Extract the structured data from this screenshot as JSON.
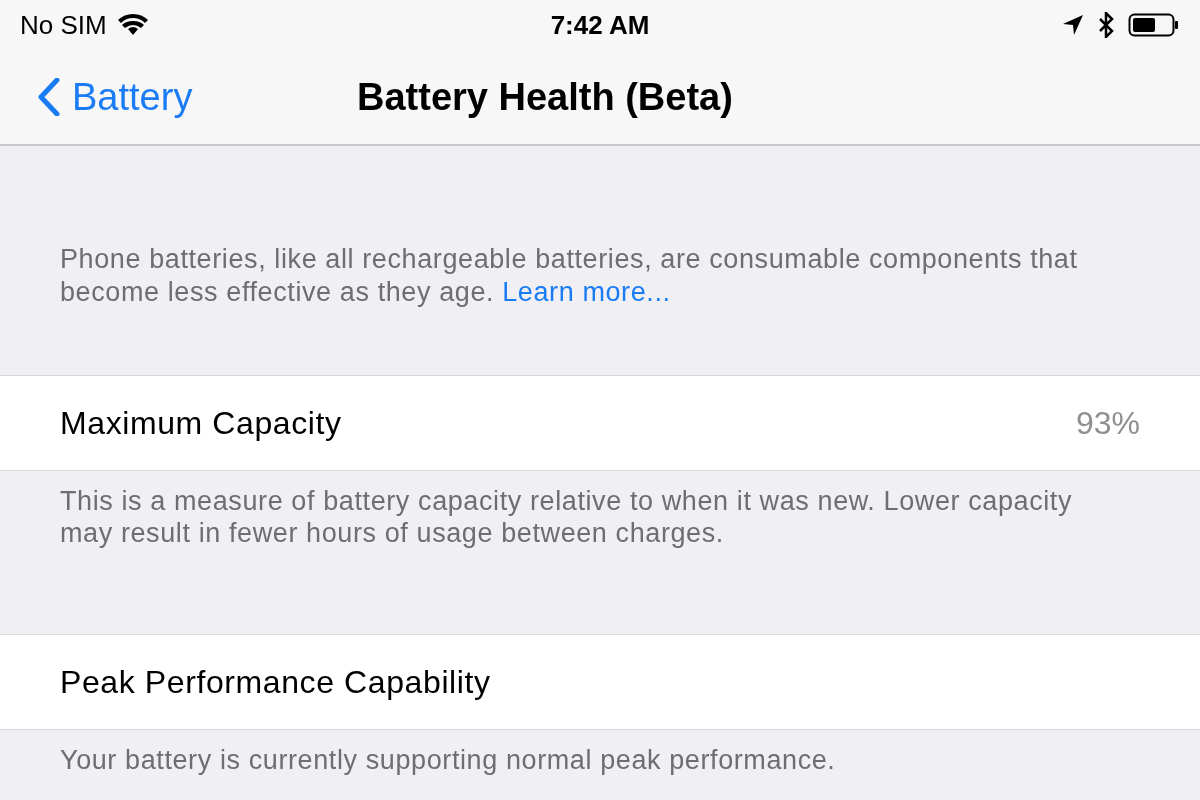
{
  "status_bar": {
    "carrier": "No SIM",
    "time": "7:42 AM"
  },
  "nav": {
    "back": "Battery",
    "title": "Battery Health (Beta)"
  },
  "intro": {
    "text": "Phone batteries, like all rechargeable batteries, are consumable components that become less effective as they age.",
    "link": "Learn more..."
  },
  "sections": [
    {
      "label": "Maximum Capacity",
      "value": "93%",
      "footer": "This is a measure of battery capacity relative to when it was new. Lower capacity may result in fewer hours of usage between charges."
    },
    {
      "label": "Peak Performance Capability",
      "footer": "Your battery is currently supporting normal peak performance."
    }
  ]
}
